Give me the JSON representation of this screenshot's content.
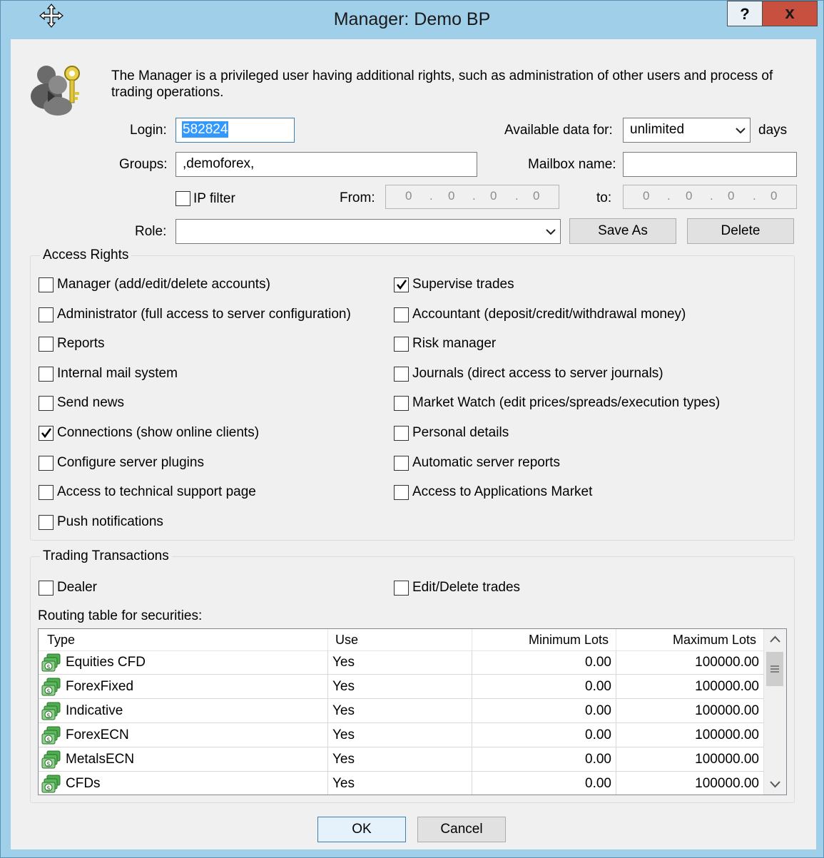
{
  "window": {
    "title": "Manager: Demo BP",
    "help_label": "?",
    "close_label": "x"
  },
  "intro": {
    "text_line1": "The Manager is a privileged user having additional rights, such as administration of other users and process of",
    "text_line2": "trading operations."
  },
  "form": {
    "login_label": "Login:",
    "login_value": "582824",
    "available_label": "Available data for:",
    "available_value": "unlimited",
    "days_label": "days",
    "groups_label": "Groups:",
    "groups_value": ",demoforex,",
    "mailbox_label": "Mailbox name:",
    "mailbox_value": "",
    "ipfilter_label": "IP filter",
    "ipfilter_checked": false,
    "from_label": "From:",
    "from_octets": [
      "0",
      "0",
      "0",
      "0"
    ],
    "to_label": "to:",
    "to_octets": [
      "0",
      "0",
      "0",
      "0"
    ],
    "ip_dot": ".",
    "role_label": "Role:",
    "role_value": "",
    "save_as_label": "Save As",
    "delete_label": "Delete"
  },
  "access_rights": {
    "title": "Access Rights",
    "left": [
      {
        "label": "Manager (add/edit/delete accounts)",
        "checked": false
      },
      {
        "label": "Administrator (full access to server configuration)",
        "checked": false
      },
      {
        "label": "Reports",
        "checked": false
      },
      {
        "label": "Internal mail system",
        "checked": false
      },
      {
        "label": "Send news",
        "checked": false
      },
      {
        "label": "Connections (show online clients)",
        "checked": true
      },
      {
        "label": "Configure server plugins",
        "checked": false
      },
      {
        "label": "Access to technical support page",
        "checked": false
      },
      {
        "label": "Push notifications",
        "checked": false
      }
    ],
    "right": [
      {
        "label": "Supervise trades",
        "checked": true
      },
      {
        "label": "Accountant (deposit/credit/withdrawal money)",
        "checked": false
      },
      {
        "label": "Risk manager",
        "checked": false
      },
      {
        "label": "Journals (direct access to server journals)",
        "checked": false
      },
      {
        "label": "Market Watch (edit prices/spreads/execution types)",
        "checked": false
      },
      {
        "label": "Personal details",
        "checked": false
      },
      {
        "label": "Automatic server reports",
        "checked": false
      },
      {
        "label": "Access to Applications Market",
        "checked": false
      }
    ]
  },
  "trading": {
    "title": "Trading Transactions",
    "dealer_label": "Dealer",
    "dealer_checked": false,
    "edit_delete_label": "Edit/Delete trades",
    "edit_delete_checked": false,
    "routing_label": "Routing table for securities:",
    "columns": [
      "Type",
      "Use",
      "Minimum Lots",
      "Maximum Lots"
    ],
    "rows": [
      {
        "type": "Equities CFD",
        "use": "Yes",
        "min": "0.00",
        "max": "100000.00"
      },
      {
        "type": "ForexFixed",
        "use": "Yes",
        "min": "0.00",
        "max": "100000.00"
      },
      {
        "type": "Indicative",
        "use": "Yes",
        "min": "0.00",
        "max": "100000.00"
      },
      {
        "type": "ForexECN",
        "use": "Yes",
        "min": "0.00",
        "max": "100000.00"
      },
      {
        "type": "MetalsECN",
        "use": "Yes",
        "min": "0.00",
        "max": "100000.00"
      },
      {
        "type": "CFDs",
        "use": "Yes",
        "min": "0.00",
        "max": "100000.00"
      }
    ]
  },
  "footer": {
    "ok_label": "OK",
    "cancel_label": "Cancel"
  },
  "colors": {
    "frame": "#9fcfe9",
    "close_button": "#c7503e",
    "client_bg": "#f0f0f0",
    "selection": "#3399ff"
  }
}
